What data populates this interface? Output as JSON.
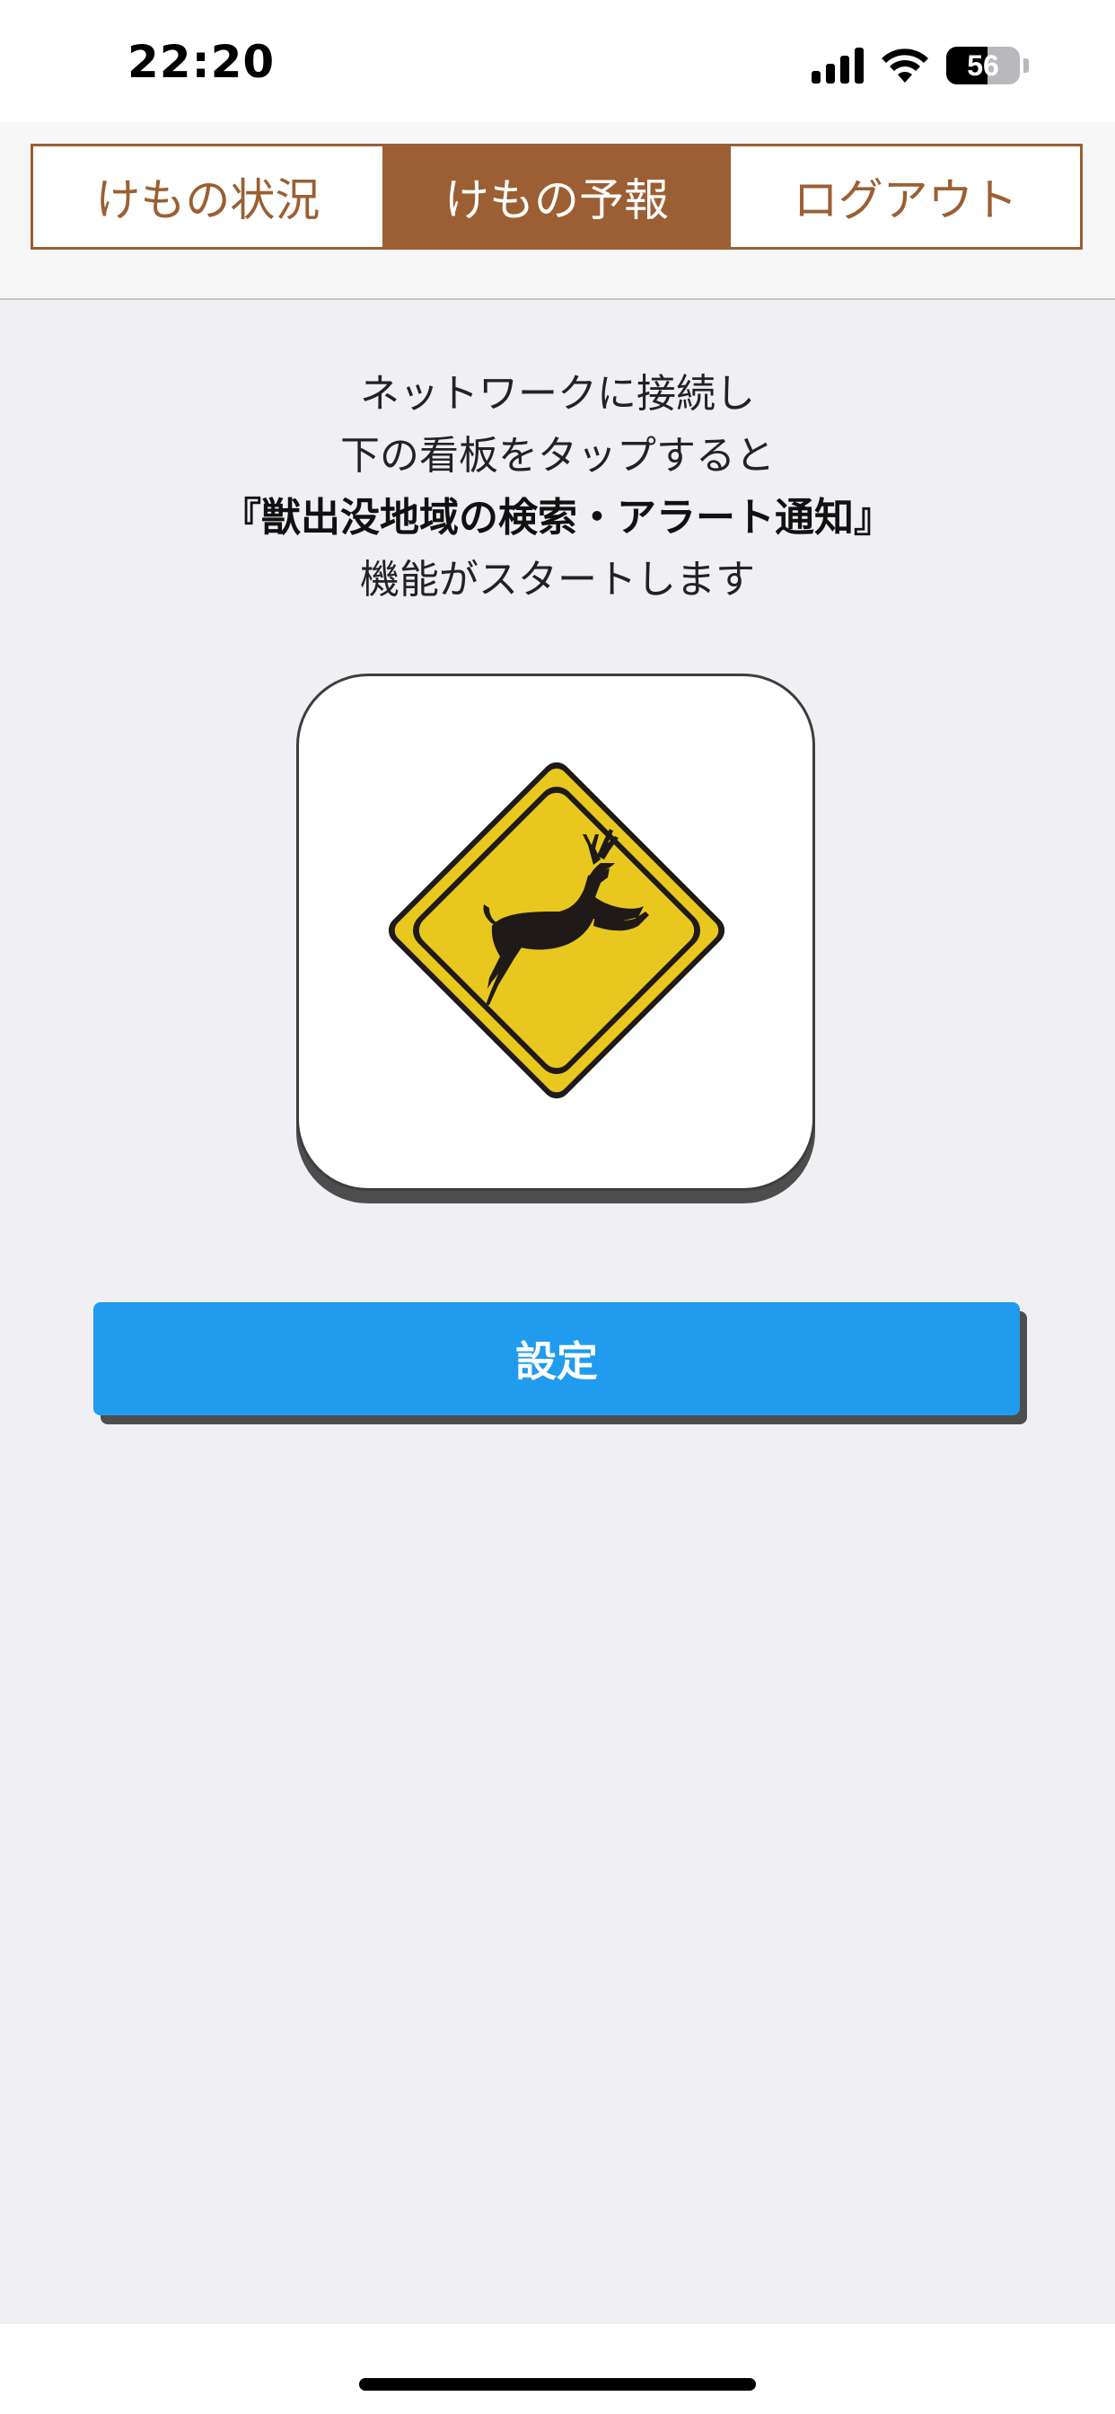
{
  "status_bar": {
    "time": "22:20",
    "battery_level": "56",
    "battery_fraction": 0.56,
    "icons": [
      "cellular-signal-icon",
      "wifi-icon",
      "battery-icon"
    ]
  },
  "tabs": [
    {
      "label": "けもの状況",
      "active": false
    },
    {
      "label": "けもの予報",
      "active": true
    },
    {
      "label": "ログアウト",
      "active": false
    }
  ],
  "intro": {
    "line1": "ネットワークに接続し",
    "line2": "下の看板をタップすると",
    "line3_bold": "『獣出没地域の検索・アラート通知』",
    "line4": "機能がスタートします"
  },
  "sign": {
    "icon": "deer-crossing-sign-icon",
    "color_fill": "#e8c81e",
    "color_border": "#1f1a17"
  },
  "settings_button": {
    "label": "設定",
    "color": "#209bee"
  },
  "colors": {
    "accent_brown": "#9b5f33",
    "background": "#efeff4"
  }
}
